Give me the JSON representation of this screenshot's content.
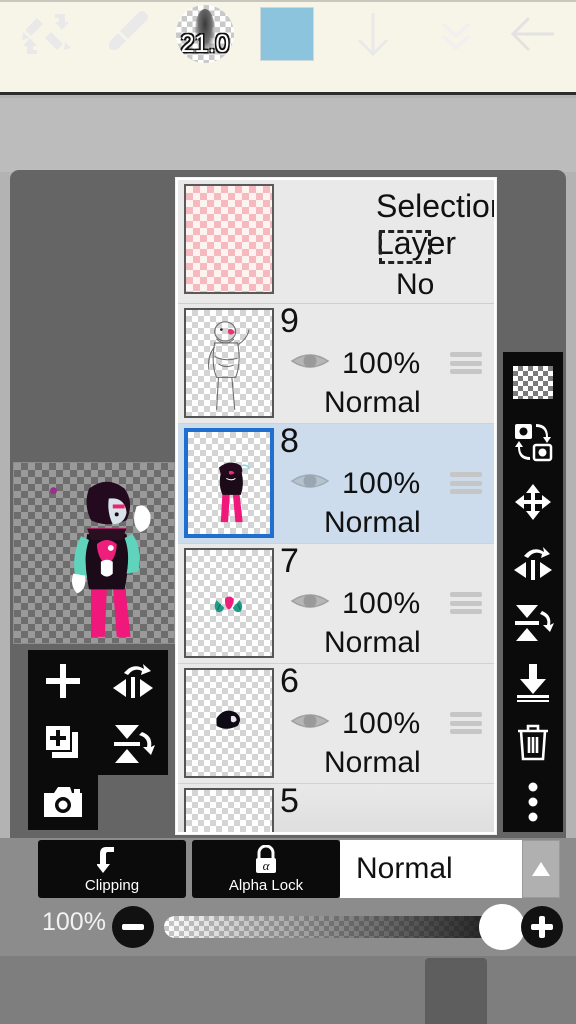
{
  "app": {
    "background_color": "#8c8c8c",
    "canvas_bg_color": "#656565",
    "top_strip_color": "#f7f5e8"
  },
  "layer_panel": {
    "selection_layer": {
      "title": "Selection Layer",
      "status": "No Selection",
      "thumb_icon": "pink-checker-thumbnail",
      "marquee_icon": "dashed-selection-marquee-icon"
    },
    "layers": [
      {
        "number": "9",
        "opacity": "100%",
        "blend_mode": "Normal",
        "selected": false,
        "visible": true,
        "thumb_icon": "layer-thumbnail-sketch"
      },
      {
        "number": "8",
        "opacity": "100%",
        "blend_mode": "Normal",
        "selected": true,
        "visible": true,
        "thumb_icon": "layer-thumbnail-figure"
      },
      {
        "number": "7",
        "opacity": "100%",
        "blend_mode": "Normal",
        "selected": false,
        "visible": true,
        "thumb_icon": "layer-thumbnail-arms"
      },
      {
        "number": "6",
        "opacity": "100%",
        "blend_mode": "Normal",
        "selected": false,
        "visible": true,
        "thumb_icon": "layer-thumbnail-hair"
      },
      {
        "number": "5",
        "opacity": "",
        "blend_mode": "",
        "selected": false,
        "visible": true,
        "thumb_icon": "layer-thumbnail-partial"
      }
    ],
    "selected_row_color": "#ccdcec",
    "selected_border_color": "#1f6fd0"
  },
  "right_toolbar": {
    "items": [
      {
        "icon": "transparency-checker-icon",
        "label": "Transparency"
      },
      {
        "icon": "swap-layers-icon",
        "label": "Swap Layers"
      },
      {
        "icon": "move-icon",
        "label": "Move"
      },
      {
        "icon": "flip-horizontal-icon",
        "label": "Flip Horizontal"
      },
      {
        "icon": "flip-vertical-icon",
        "label": "Flip Vertical"
      },
      {
        "icon": "merge-down-icon",
        "label": "Merge Down"
      },
      {
        "icon": "trash-icon",
        "label": "Delete Layer"
      },
      {
        "icon": "more-options-icon",
        "label": "More"
      }
    ]
  },
  "left_panel": {
    "items": [
      {
        "icon": "add-layer-icon",
        "label": "Add Layer"
      },
      {
        "icon": "flip-horizontal-icon",
        "label": "Flip Horizontal"
      },
      {
        "icon": "duplicate-layer-icon",
        "label": "Duplicate Layer"
      },
      {
        "icon": "flip-vertical-icon",
        "label": "Flip Vertical"
      },
      {
        "icon": "camera-icon",
        "label": "Camera"
      }
    ]
  },
  "options_bar": {
    "clipping_label": "Clipping",
    "clipping_icon": "clipping-arrow-icon",
    "alpha_lock_label": "Alpha Lock",
    "alpha_lock_icon": "alpha-lock-icon",
    "blend_mode_value": "Normal",
    "blend_arrow_icon": "triangle-up-icon",
    "opacity_value": "100%",
    "minus_icon": "minus-icon",
    "plus_icon": "plus-icon",
    "slider_position_percent": 100
  },
  "tool_bar": {
    "items": [
      {
        "icon": "brush-eraser-swap-icon",
        "label": "Swap Brush/Eraser"
      },
      {
        "icon": "brush-icon",
        "label": "Brush"
      },
      {
        "icon": "brush-size-icon",
        "label": "Brush Size"
      },
      {
        "icon": "color-swatch-icon",
        "label": "Color"
      },
      {
        "icon": "arrow-down-icon",
        "label": "Down"
      },
      {
        "icon": "chevron-double-down-icon",
        "label": "Collapse"
      },
      {
        "icon": "arrow-left-icon",
        "label": "Back"
      }
    ],
    "brush_size": "21.0",
    "color_swatch_hex": "#8cc3dd"
  }
}
